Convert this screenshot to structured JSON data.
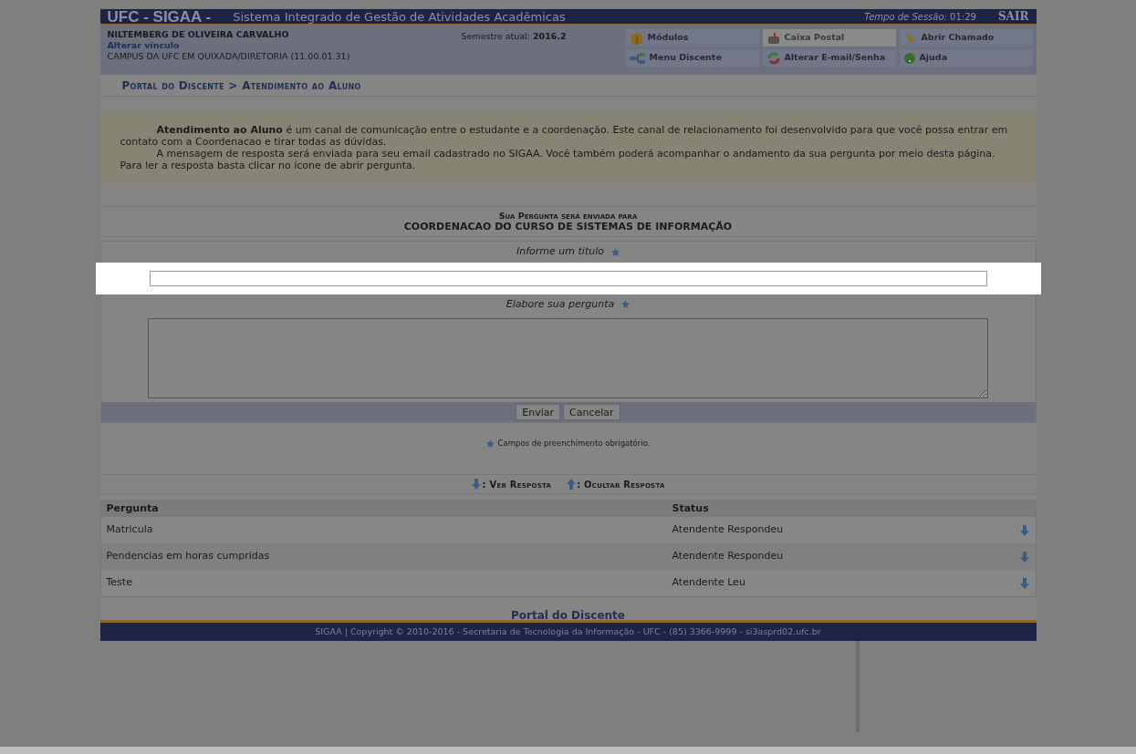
{
  "header": {
    "system": "UFC - SIGAA -",
    "title": "Sistema Integrado de Gestão de Atividades Acadêmicas",
    "session_label": "Tempo de Sessão:",
    "session_time": "01:29",
    "logout": "SAIR"
  },
  "user": {
    "name": "NILTEMBERG DE OLIVEIRA CARVALHO",
    "link": "Alterar vínculo",
    "unit": "CAMPUS DA UFC EM QUIXADA/DIRETORIA (11.00.01.31)",
    "semester_label": "Semestre atual:",
    "semester": "2016.2"
  },
  "menu": [
    {
      "label": "Módulos",
      "disabled": false
    },
    {
      "label": "Caixa Postal",
      "disabled": true
    },
    {
      "label": "Abrir Chamado",
      "disabled": false
    },
    {
      "label": "Menu Discente",
      "disabled": false
    },
    {
      "label": "Alterar E-mail/Senha",
      "disabled": false
    },
    {
      "label": "Ajuda",
      "disabled": false
    }
  ],
  "breadcrumb": "Portal do Discente > Atendimento ao Aluno",
  "intro": [
    "**Atendimento ao Aluno** é um canal de comunicação entre o estudante e a coordenação. Este canal de relacionamento foi desenvolvido para que você possa entrar em contato com a Coordenacao e tirar todas as dúvidas.",
    "A mensagem de resposta será enviada para seu email cadastrado no SIGAA. Você também poderá acompanhar o andamento da sua pergunta por meio desta página. Para ler a resposta basta clicar no ícone de abrir pergunta."
  ],
  "section": {
    "heading": "Sua Pergunta será enviada para",
    "recipient": "COORDENACAO DO CURSO DE SISTEMAS DE INFORMAÇÃO"
  },
  "fields": [
    {
      "label": "Informe um titulo",
      "kind": "input",
      "highlighted": true
    },
    {
      "label": "Elabore sua pergunta",
      "kind": "textarea",
      "highlighted": false
    }
  ],
  "buttons": [
    "Enviar",
    "Cancelar"
  ],
  "required_note": "Campos de preenchimento obrigatório.",
  "legend": [
    ": Ver Resposta",
    ": Ocultar Resposta"
  ],
  "table": {
    "columns": [
      "Pergunta",
      "Status"
    ],
    "rows": [
      {
        "question": "Matricula",
        "status": "Atendente Respondeu"
      },
      {
        "question": "Pendencias em horas cumpridas",
        "status": "Atendente Respondeu"
      },
      {
        "question": "Teste",
        "status": "Atendente Leu"
      }
    ]
  },
  "footer_link": "Portal do Discente",
  "footer": "SIGAA | Copyright © 2010-2016 - Secretaria de Tecnologia da Informação - UFC - (85) 3366-9999 - si3asprd02.ufc.br"
}
